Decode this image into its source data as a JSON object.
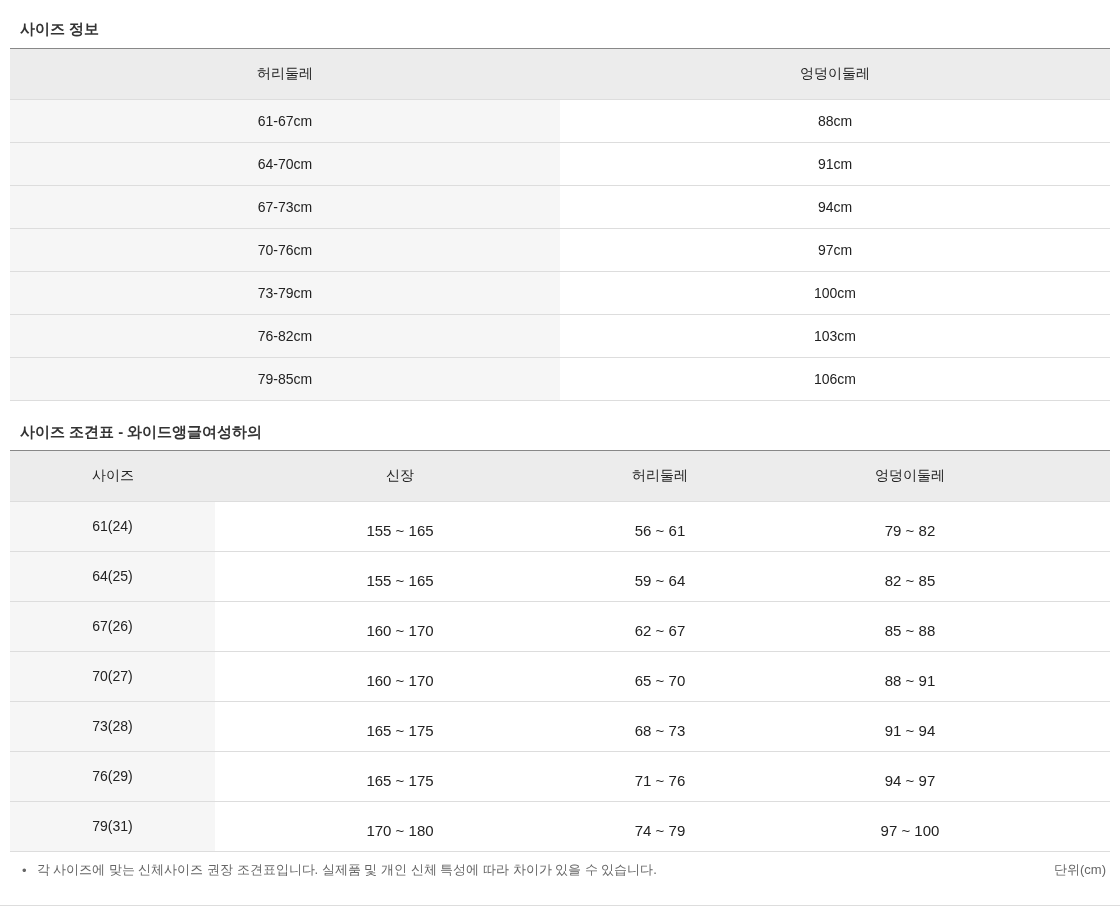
{
  "size_info": {
    "title": "사이즈 정보",
    "columns": [
      "허리둘레",
      "엉덩이둘레"
    ],
    "rows": [
      [
        "61-67cm",
        "88cm"
      ],
      [
        "64-70cm",
        "91cm"
      ],
      [
        "67-73cm",
        "94cm"
      ],
      [
        "70-76cm",
        "97cm"
      ],
      [
        "73-79cm",
        "100cm"
      ],
      [
        "76-82cm",
        "103cm"
      ],
      [
        "79-85cm",
        "106cm"
      ]
    ]
  },
  "size_chart": {
    "title": "사이즈 조견표 - 와이드앵글여성하의",
    "columns": [
      "사이즈",
      "신장",
      "허리둘레",
      "엉덩이둘레"
    ],
    "rows": [
      [
        "61(24)",
        "155 ~ 165",
        "56 ~ 61",
        "79 ~ 82"
      ],
      [
        "64(25)",
        "155 ~ 165",
        "59 ~ 64",
        "82 ~ 85"
      ],
      [
        "67(26)",
        "160 ~ 170",
        "62 ~ 67",
        "85 ~ 88"
      ],
      [
        "70(27)",
        "160 ~ 170",
        "65 ~ 70",
        "88 ~ 91"
      ],
      [
        "73(28)",
        "165 ~ 175",
        "68 ~ 73",
        "91 ~ 94"
      ],
      [
        "76(29)",
        "165 ~ 175",
        "71 ~ 76",
        "94 ~ 97"
      ],
      [
        "79(31)",
        "170 ~ 180",
        "74 ~ 79",
        "97 ~ 100"
      ]
    ]
  },
  "note": {
    "bullet": "•",
    "text": "각 사이즈에 맞는 신체사이즈 권장 조견표입니다. 실제품 및 개인 신체 특성에 따라 차이가 있을 수 있습니다.",
    "unit": "단위(cm)"
  }
}
